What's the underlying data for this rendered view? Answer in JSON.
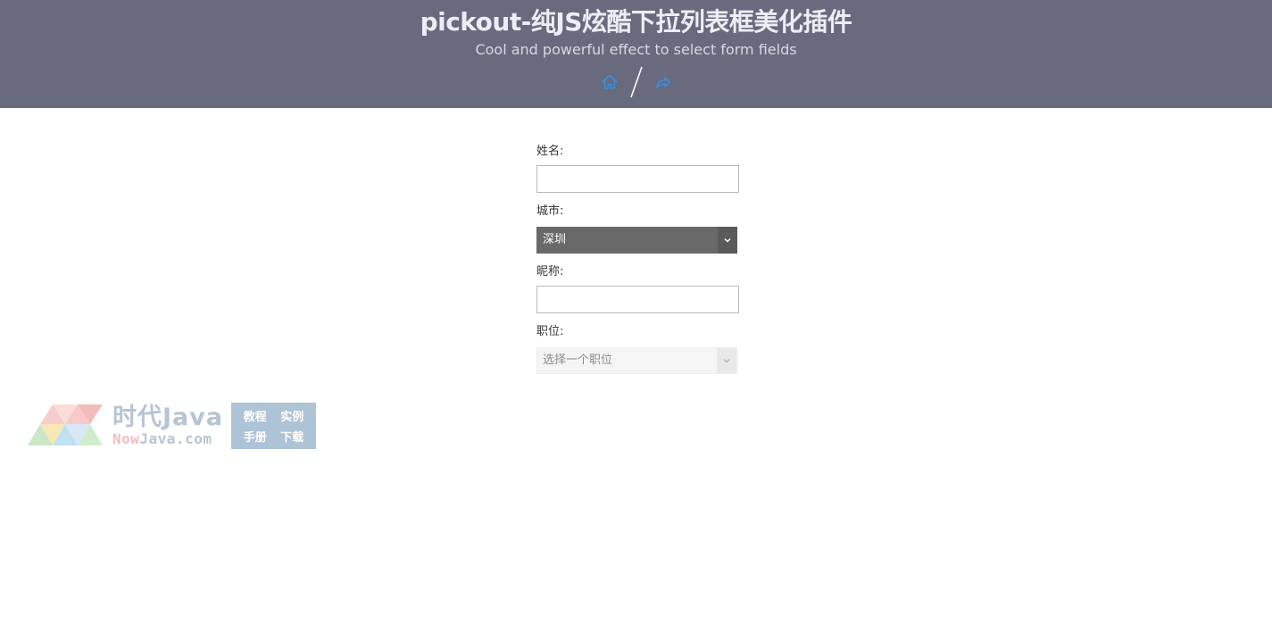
{
  "header": {
    "title": "pickout-纯JS炫酷下拉列表框美化插件",
    "subtitle": "Cool and powerful effect to select form fields",
    "nav": {
      "home_icon": "home-icon",
      "share_icon": "share-icon",
      "icon_color": "#3a8fdd"
    },
    "background_color": "#686a7d"
  },
  "form": {
    "name": {
      "label": "姓名:",
      "value": ""
    },
    "city": {
      "label": "城市:",
      "selected": "深圳"
    },
    "nickname": {
      "label": "昵称:",
      "value": ""
    },
    "position": {
      "label": "职位:",
      "placeholder": "选择一个职位"
    }
  },
  "watermark": {
    "title": "时代Java",
    "domain_prefix": "Now",
    "domain_rest": "Java.com",
    "box_items": [
      "教程",
      "实例",
      "手册",
      "下载"
    ]
  }
}
